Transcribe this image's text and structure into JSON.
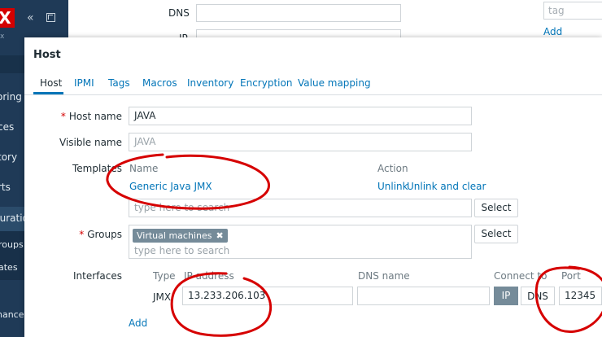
{
  "sidebar": {
    "logo": "X",
    "sub": "x",
    "items": [
      {
        "label": "oring"
      },
      {
        "label": "ces"
      },
      {
        "label": "tory"
      },
      {
        "label": "rts"
      },
      {
        "label": "guration"
      },
      {
        "label": "roups"
      },
      {
        "label": "ates"
      },
      {
        "label": "nance"
      }
    ]
  },
  "background": {
    "dns_label": "DNS",
    "ip_label": "IP",
    "tag_placeholder": "tag",
    "add_link": "Add"
  },
  "modal": {
    "title": "Host",
    "tabs": [
      "Host",
      "IPMI",
      "Tags",
      "Macros",
      "Inventory",
      "Encryption",
      "Value mapping"
    ],
    "host_name": {
      "label": "Host name",
      "value": "JAVA"
    },
    "visible_name": {
      "label": "Visible name",
      "placeholder": "JAVA"
    },
    "templates": {
      "label": "Templates",
      "col_name": "Name",
      "col_action": "Action",
      "items": [
        {
          "name": "Generic Java JMX",
          "unlink": "Unlink",
          "unlink_clear": "Unlink and clear"
        }
      ],
      "search_placeholder": "type here to search",
      "select_button": "Select"
    },
    "groups": {
      "label": "Groups",
      "chips": [
        "Virtual machines"
      ],
      "search_placeholder": "type here to search",
      "select_button": "Select"
    },
    "interfaces": {
      "label": "Interfaces",
      "col_type": "Type",
      "col_ip": "IP address",
      "col_dns": "DNS name",
      "col_connect": "Connect to",
      "col_port": "Port",
      "rows": [
        {
          "type": "JMX",
          "ip": "13.233.206.103",
          "dns": "",
          "connect_ip": "IP",
          "connect_dns": "DNS",
          "port": "12345"
        }
      ],
      "add_link": "Add"
    }
  },
  "colors": {
    "link": "#0275b8",
    "sidebar": "#1f3a57",
    "annotation": "#d60000"
  }
}
